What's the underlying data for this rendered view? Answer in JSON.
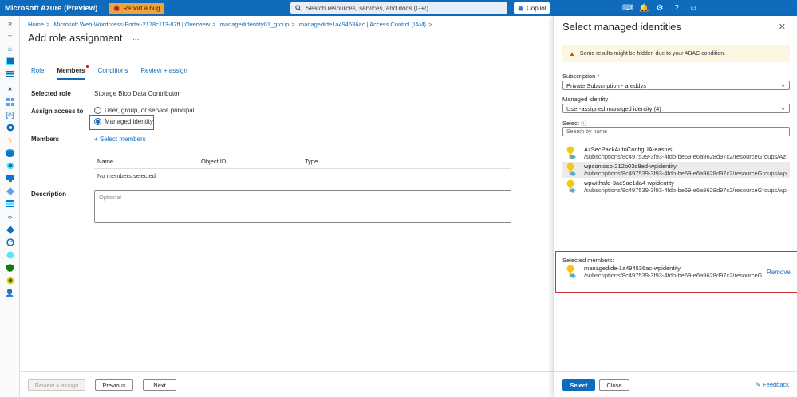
{
  "topbar": {
    "brand": "Microsoft Azure (Preview)",
    "report_bug": "Report a bug",
    "search_placeholder": "Search resources, services, and docs (G+/)",
    "copilot": "Copilot"
  },
  "breadcrumb": {
    "items": [
      "Home",
      "Microsoft.Web-Wordpress-Portal-2178c113-87ff | Overview",
      "managedidentity01_group",
      "managedide1a494536ac | Access Control (IAM)"
    ]
  },
  "page": {
    "title": "Add role assignment",
    "more": "...",
    "tabs": [
      {
        "label": "Role"
      },
      {
        "label": "Members"
      },
      {
        "label": "Conditions"
      },
      {
        "label": "Review + assign"
      }
    ],
    "selected_role_label": "Selected role",
    "selected_role_value": "Storage Blob Data Contributor",
    "assign_access_label": "Assign access to",
    "option_user": "User, group, or service principal",
    "option_managed": "Managed identity",
    "members_label": "Members",
    "select_members": "+ Select members",
    "table_headers": [
      "Name",
      "Object ID",
      "Type"
    ],
    "no_members": "No members selected",
    "description_label": "Description",
    "description_placeholder": "Optional"
  },
  "footer": {
    "review_assign": "Review + assign",
    "previous": "Previous",
    "next": "Next"
  },
  "panel": {
    "title": "Select managed identities",
    "warning": "Some results might be hidden due to your ABAC condition.",
    "subscription_label": "Subscription",
    "required_mark": "*",
    "subscription_value": "Private Subscription - areddys",
    "managed_identity_label": "Managed identity",
    "managed_identity_value": "User-assigned managed identity (4)",
    "select_label": "Select",
    "search_placeholder": "Search by name",
    "identities": [
      {
        "name": "AzSecPackAutoConfigUA-eastus",
        "path": "/subscriptions/8c497539-3f93-4fdb-be69-e6a9628d97c2/resourceGroups/AzSecPa..."
      },
      {
        "name": "wpcontoso-212b03d8ed-wpidentity",
        "path": "/subscriptions/8c497539-3f93-4fdb-be69-e6a9628d97c2/resourceGroups/wpcont..."
      },
      {
        "name": "wpwithafd-3ae9ac1da4-wpidentity",
        "path": "/subscriptions/8c497539-3f93-4fdb-be69-e6a9628d97c2/resourceGroups/wpwitha..."
      }
    ],
    "selected_members_label": "Selected members:",
    "selected": {
      "name": "managedide-1a494536ac-wpidentity",
      "path": "/subscriptions/8c497539-3f93-4fdb-be69-e6a9628d97c2/resourceGroups/..."
    },
    "remove": "Remove",
    "select_button": "Select",
    "close_button": "Close",
    "feedback": "Feedback"
  }
}
